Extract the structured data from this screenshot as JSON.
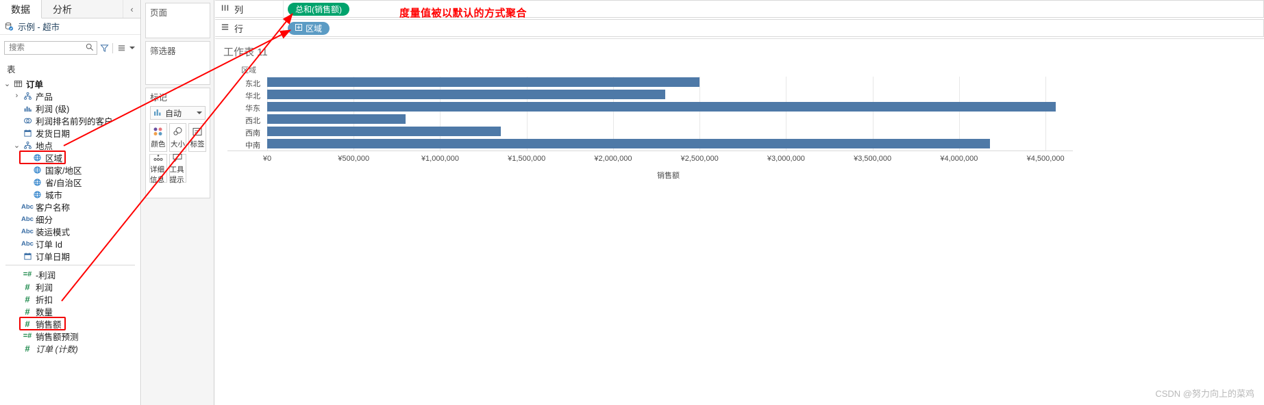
{
  "left_pane": {
    "tabs": [
      {
        "label": "数据",
        "active": true
      },
      {
        "label": "分析",
        "active": false
      }
    ],
    "collapse_icon": "chevron-left-icon",
    "datasource": {
      "icon": "database-icon",
      "label": "示例 - 超市"
    },
    "search": {
      "placeholder": "搜索",
      "value": "",
      "icon": "search-icon"
    },
    "toolbar": {
      "filter_icon": "funnel-icon",
      "grid_icon": "grid-icon",
      "dropdown_icon": "caret-down-icon"
    },
    "section_label": "表",
    "fields": [
      {
        "label": "订单",
        "icon": "table-icon",
        "indent": 0,
        "twisty": "expanded",
        "bold": true,
        "italic": false,
        "highlight": false
      },
      {
        "label": "产品",
        "icon": "hierarchy-icon",
        "indent": 1,
        "twisty": "collapsed",
        "bold": false,
        "italic": false,
        "highlight": false
      },
      {
        "label": "利润 (级)",
        "icon": "bin-icon",
        "indent": 1,
        "twisty": "none",
        "bold": false,
        "italic": false,
        "highlight": false
      },
      {
        "label": "利润排名前列的客户",
        "icon": "set-icon",
        "indent": 1,
        "twisty": "none",
        "bold": false,
        "italic": false,
        "highlight": false
      },
      {
        "label": "发货日期",
        "icon": "calendar-icon",
        "indent": 1,
        "twisty": "none",
        "bold": false,
        "italic": false,
        "highlight": false
      },
      {
        "label": "地点",
        "icon": "hierarchy-icon",
        "indent": 1,
        "twisty": "expanded",
        "bold": false,
        "italic": false,
        "highlight": false
      },
      {
        "label": "区域",
        "icon": "globe-icon",
        "indent": 2,
        "twisty": "none",
        "bold": false,
        "italic": false,
        "highlight": true
      },
      {
        "label": "国家/地区",
        "icon": "globe-icon",
        "indent": 2,
        "twisty": "none",
        "bold": false,
        "italic": false,
        "highlight": false
      },
      {
        "label": "省/自治区",
        "icon": "globe-icon",
        "indent": 2,
        "twisty": "none",
        "bold": false,
        "italic": false,
        "highlight": false
      },
      {
        "label": "城市",
        "icon": "globe-icon",
        "indent": 2,
        "twisty": "none",
        "bold": false,
        "italic": false,
        "highlight": false
      },
      {
        "label": "客户名称",
        "icon": "abc-icon",
        "indent": 1,
        "twisty": "none",
        "bold": false,
        "italic": false,
        "highlight": false
      },
      {
        "label": "细分",
        "icon": "abc-icon",
        "indent": 1,
        "twisty": "none",
        "bold": false,
        "italic": false,
        "highlight": false
      },
      {
        "label": "装运模式",
        "icon": "abc-icon",
        "indent": 1,
        "twisty": "none",
        "bold": false,
        "italic": false,
        "highlight": false
      },
      {
        "label": "订单 Id",
        "icon": "abc-icon",
        "indent": 1,
        "twisty": "none",
        "bold": false,
        "italic": false,
        "highlight": false
      },
      {
        "label": "订单日期",
        "icon": "calendar-icon",
        "indent": 1,
        "twisty": "none",
        "bold": false,
        "italic": false,
        "highlight": false
      },
      {
        "label": "-利润",
        "icon": "calc-number-icon",
        "indent": 1,
        "twisty": "none",
        "bold": false,
        "italic": false,
        "highlight": false
      },
      {
        "label": "利润",
        "icon": "number-icon",
        "indent": 1,
        "twisty": "none",
        "bold": false,
        "italic": false,
        "highlight": false
      },
      {
        "label": "折扣",
        "icon": "number-icon",
        "indent": 1,
        "twisty": "none",
        "bold": false,
        "italic": false,
        "highlight": false
      },
      {
        "label": "数量",
        "icon": "number-icon",
        "indent": 1,
        "twisty": "none",
        "bold": false,
        "italic": false,
        "highlight": false
      },
      {
        "label": "销售额",
        "icon": "number-icon",
        "indent": 1,
        "twisty": "none",
        "bold": false,
        "italic": false,
        "highlight": true
      },
      {
        "label": "销售额预测",
        "icon": "calc-number-icon",
        "indent": 1,
        "twisty": "none",
        "bold": false,
        "italic": false,
        "highlight": false
      },
      {
        "label": "订单 (计数)",
        "icon": "number-icon",
        "indent": 1,
        "twisty": "none",
        "bold": false,
        "italic": true,
        "highlight": false
      }
    ]
  },
  "cards": {
    "pages": {
      "title": "页面"
    },
    "filters": {
      "title": "筛选器"
    },
    "marks": {
      "title": "标记",
      "type": {
        "label": "自动",
        "icon": "bar-chart-icon",
        "dropdown_icon": "caret-down-icon"
      },
      "buttons": [
        {
          "label": "颜色",
          "icon": "color-icon"
        },
        {
          "label": "大小",
          "icon": "size-icon"
        },
        {
          "label": "标签",
          "icon": "label-icon"
        },
        {
          "label": "详细信息",
          "icon": "detail-icon"
        },
        {
          "label": "工具提示",
          "icon": "tooltip-icon"
        }
      ]
    }
  },
  "shelves": {
    "columns": {
      "label": "列",
      "icon": "columns-icon",
      "pills": [
        {
          "text": "总和(销售额)",
          "color": "green"
        }
      ]
    },
    "rows": {
      "label": "行",
      "icon": "rows-icon",
      "pills": [
        {
          "text": "区域",
          "color": "blue",
          "plus_icon": "plus-box-icon"
        }
      ]
    }
  },
  "annotation": {
    "text": "度量值被以默认的方式聚合",
    "color": "#ff0000"
  },
  "worksheet": {
    "title": "工作表 11"
  },
  "watermark": "CSDN @努力向上的菜鸡",
  "chart_data": {
    "type": "bar",
    "orientation": "horizontal",
    "title": "工作表 11",
    "row_header_title": "区域",
    "categories": [
      "东北",
      "华北",
      "华东",
      "西北",
      "西南",
      "中南"
    ],
    "values": [
      2500000,
      2300000,
      4560000,
      800000,
      1350000,
      4180000
    ],
    "xlabel": "销售额",
    "ylabel": "区域",
    "xlim": [
      0,
      4650000
    ],
    "xticks": [
      "¥0",
      "¥500,000",
      "¥1,000,000",
      "¥1,500,000",
      "¥2,000,000",
      "¥2,500,000",
      "¥3,000,000",
      "¥3,500,000",
      "¥4,000,000",
      "¥4,500,000"
    ],
    "xtick_values": [
      0,
      500000,
      1000000,
      1500000,
      2000000,
      2500000,
      3000000,
      3500000,
      4000000,
      4500000
    ],
    "bar_color": "#4e79a7",
    "grid": true,
    "legend": "none"
  }
}
